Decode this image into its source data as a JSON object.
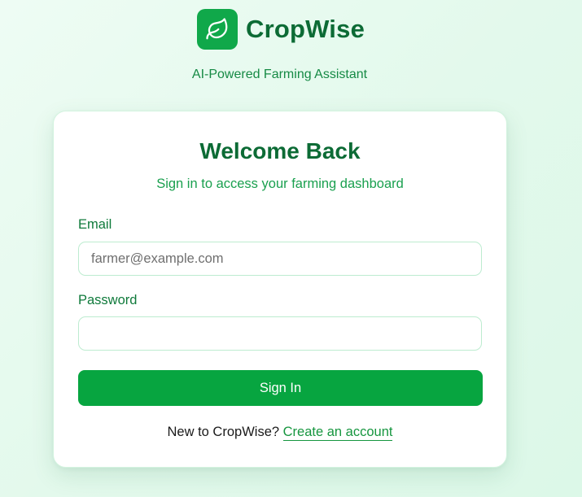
{
  "brand": {
    "name": "CropWise",
    "tagline": "AI-Powered Farming Assistant",
    "logo_icon": "leaf-icon"
  },
  "login": {
    "title": "Welcome Back",
    "subtitle": "Sign in to access your farming dashboard",
    "email_label": "Email",
    "email_placeholder": "farmer@example.com",
    "email_value": "",
    "password_label": "Password",
    "password_placeholder": "",
    "password_value": "",
    "signin_label": "Sign In",
    "footer_text": "New to CropWise?",
    "create_account_label": "Create an account"
  },
  "colors": {
    "brand_green": "#10a84a",
    "dark_green": "#0c6b35",
    "button_green": "#07a540",
    "background": "#e3f9ec"
  }
}
